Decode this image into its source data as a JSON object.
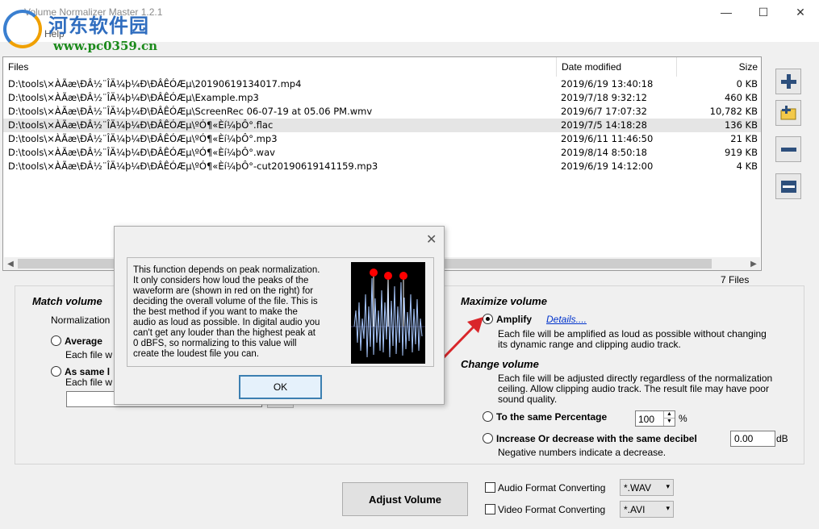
{
  "window": {
    "title": "Volume Normalizer Master 1.2.1",
    "minimize": "—",
    "maximize": "☐",
    "close": "✕"
  },
  "menu": {
    "help": "Help"
  },
  "watermark": {
    "title": "河东软件园",
    "url": "www.pc0359.cn"
  },
  "filelist": {
    "headers": {
      "files": "Files",
      "date": "Date modified",
      "size": "Size"
    },
    "rows": [
      {
        "path": "D:\\tools\\×ÀÃæ\\ÐÂ½¨ÎÄ¼þ¼Ð\\ÐÂÊÓÆµ\\20190619134017.mp4",
        "date": "2019/6/19 13:40:18",
        "size": "0 KB"
      },
      {
        "path": "D:\\tools\\×ÀÃæ\\ÐÂ½¨ÎÄ¼þ¼Ð\\ÐÂÊÓÆµ\\Example.mp3",
        "date": "2019/7/18 9:32:12",
        "size": "460 KB"
      },
      {
        "path": "D:\\tools\\×ÀÃæ\\ÐÂ½¨ÎÄ¼þ¼Ð\\ÐÂÊÓÆµ\\ScreenRec 06-07-19 at 05.06 PM.wmv",
        "date": "2019/6/7 17:07:32",
        "size": "10,782 KB"
      },
      {
        "path": "D:\\tools\\×ÀÃæ\\ÐÂ½¨ÎÄ¼þ¼Ð\\ÐÂÊÓÆµ\\ºÓ¶«Èí¼þÔ°.flac",
        "date": "2019/7/5 14:18:28",
        "size": "136 KB"
      },
      {
        "path": "D:\\tools\\×ÀÃæ\\ÐÂ½¨ÎÄ¼þ¼Ð\\ÐÂÊÓÆµ\\ºÓ¶«Èí¼þÔ°.mp3",
        "date": "2019/6/11 11:46:50",
        "size": "21 KB"
      },
      {
        "path": "D:\\tools\\×ÀÃæ\\ÐÂ½¨ÎÄ¼þ¼Ð\\ÐÂÊÓÆµ\\ºÓ¶«Èí¼þÔ°.wav",
        "date": "2019/8/14 8:50:18",
        "size": "919 KB"
      },
      {
        "path": "D:\\tools\\×ÀÃæ\\ÐÂ½¨ÎÄ¼þ¼Ð\\ÐÂÊÓÆµ\\ºÓ¶«Èí¼þÔ°-cut20190619141159.mp3",
        "date": "2019/6/19 14:12:00",
        "size": "4 KB"
      }
    ],
    "selected_row": 3,
    "count": "7 Files"
  },
  "match_volume": {
    "heading": "Match volume",
    "normalization_label": "Normalization",
    "average_label": "Average",
    "average_desc": "Each file w",
    "same_label": "As same l",
    "same_desc": "Each file w"
  },
  "maximize": {
    "heading": "Maximize volume",
    "amplify_label": "Amplify",
    "details_link": "Details....",
    "amplify_desc_1": "Each file will be amplified as loud as possible without changing",
    "amplify_desc_2": "its dynamic range and clipping audio track."
  },
  "change": {
    "heading": "Change volume",
    "desc_1": "Each file will be adjusted directly regardless of the normalization",
    "desc_2": "ceiling. Allow clipping audio track. The result file may have poor",
    "desc_3": "sound quality.",
    "percentage_label": "To the same Percentage",
    "percentage_value": "100",
    "percent_unit": "%",
    "decibel_label": "Increase Or decrease with the same decibel",
    "decibel_value": "0.00",
    "db_unit": "dB",
    "negative_note": "Negative numbers indicate a decrease."
  },
  "actions": {
    "adjust": "Adjust Volume",
    "audio_label": "Audio Format Converting",
    "audio_value": "*.WAV",
    "video_label": "Video Format Converting",
    "video_value": "*.AVI"
  },
  "dialog": {
    "text": [
      "This function depends on peak normalization.",
      "It only considers how loud the peaks of the",
      "waveform are (shown in red on the right) for",
      "deciding the overall volume of the file. This is",
      "the best method if you want to make the",
      "audio as loud as possible. In digital audio you",
      "can't get any louder than the highest peak at",
      "0 dBFS, so normalizing to this value will",
      "create the loudest file you can."
    ],
    "ok": "OK",
    "close": "✕"
  },
  "colors": {
    "accent": "#0078d7",
    "arrow": "#d9262a",
    "peak": "#ff0000",
    "wave": "#a8c8ff"
  }
}
